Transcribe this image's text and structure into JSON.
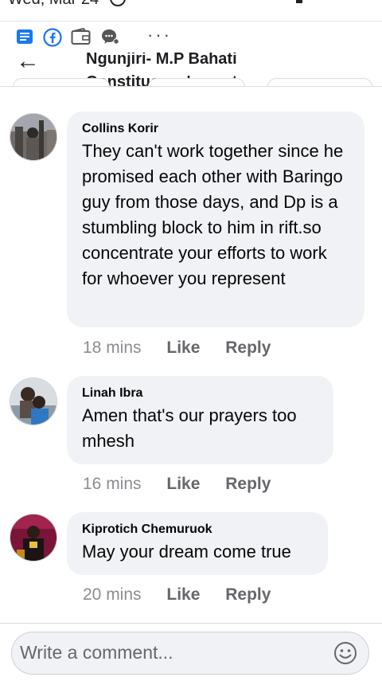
{
  "status_bar": {
    "time": "Wed, Mar 24"
  },
  "post_header": {
    "title": "Ngunjiri- M.P Bahati Constituency's post"
  },
  "comments": [
    {
      "author": "Collins Korir",
      "text": "They can't work together since he promised each other with Baringo guy from those days, and Dp is a stumbling block to him in rift.so concentrate your efforts to work for whoever you represent",
      "time": "18 mins",
      "like": "Like",
      "reply": "Reply"
    },
    {
      "author": "Linah Ibra",
      "text": "Amen that's our prayers too mhesh",
      "time": "16 mins",
      "like": "Like",
      "reply": "Reply"
    },
    {
      "author": "Kiprotich Chemuruok",
      "text": "May your dream come true",
      "time": "20 mins",
      "like": "Like",
      "reply": "Reply"
    }
  ],
  "composer": {
    "placeholder": "Write a comment..."
  },
  "colors": {
    "bubble": "#f0f2f5",
    "meta_text": "#65676b",
    "facebook_blue": "#1877f2"
  },
  "icons": [
    "news-icon",
    "facebook-icon",
    "wallet-icon",
    "messenger-icon",
    "more-icon",
    "back-arrow-icon",
    "emoji-icon"
  ]
}
